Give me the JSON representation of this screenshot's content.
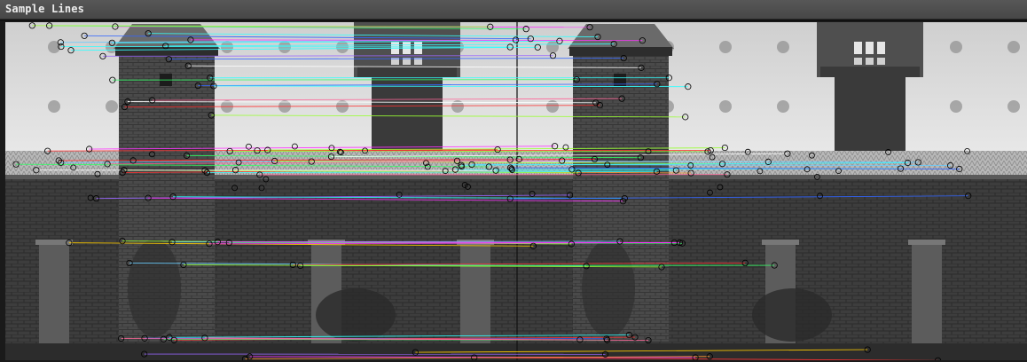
{
  "window": {
    "title": "Sample Lines"
  },
  "image": {
    "description_colors": {
      "sky": "#d9d9d9",
      "wall": "#3e3e3e",
      "roof": "#bdbdbd",
      "tower": "#4a4a4a",
      "ground": "#2c2c2c"
    },
    "match_line_colors": [
      "#ff3333",
      "#33ff66",
      "#3366ff",
      "#ffcc00",
      "#ff33ff",
      "#33ffff",
      "#9966ff",
      "#99ff33",
      "#ff9933",
      "#66ccff",
      "#ffffff",
      "#ff6699"
    ]
  }
}
